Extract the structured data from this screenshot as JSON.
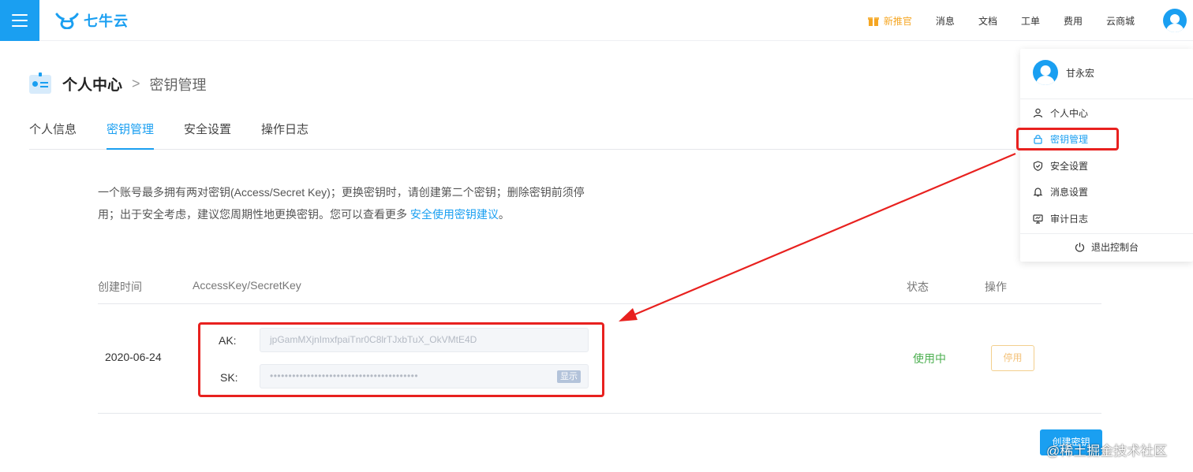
{
  "brand": {
    "name": "七牛云",
    "color": "#1a9ff1"
  },
  "topbar": {
    "promo": "新推官",
    "links": [
      "消息",
      "文档",
      "工单",
      "费用",
      "云商城"
    ]
  },
  "breadcrumb": {
    "main": "个人中心",
    "separator": ">",
    "current": "密钥管理"
  },
  "tabs": [
    {
      "label": "个人信息",
      "active": false
    },
    {
      "label": "密钥管理",
      "active": true
    },
    {
      "label": "安全设置",
      "active": false
    },
    {
      "label": "操作日志",
      "active": false
    }
  ],
  "description": {
    "line1": "一个账号最多拥有两对密钥(Access/Secret Key)；更换密钥时，请创建第二个密钥；删除密钥前须停",
    "line2": "用；出于安全考虑，建议您周期性地更换密钥。您可以查看更多 ",
    "link": "安全使用密钥建议",
    "suffix": "。"
  },
  "table": {
    "headers": {
      "created": "创建时间",
      "keys": "AccessKey/SecretKey",
      "status": "状态",
      "action": "操作"
    },
    "rows": [
      {
        "created": "2020-06-24",
        "ak_label": "AK:",
        "ak_value": "jpGamMXjnImxfpaiTnr0C8lrTJxbTuX_OkVMtE4D",
        "sk_label": "SK:",
        "sk_value": "••••••••••••••••••••••••••••••••••••••••",
        "show_label": "显示",
        "status": "使用中",
        "action": "停用"
      }
    ]
  },
  "create_button": "创建密钥",
  "dropdown": {
    "username": "甘永宏",
    "items": [
      {
        "label": "个人中心",
        "icon": "user-icon",
        "active": false
      },
      {
        "label": "密钥管理",
        "icon": "lock-icon",
        "active": true
      },
      {
        "label": "安全设置",
        "icon": "shield-icon",
        "active": false
      },
      {
        "label": "消息设置",
        "icon": "bell-icon",
        "active": false
      },
      {
        "label": "审计日志",
        "icon": "monitor-icon",
        "active": false
      }
    ],
    "logout": "退出控制台"
  },
  "watermark": "@稀土掘金技术社区",
  "colors": {
    "accent": "#1a9ff1",
    "annotation_red": "#e8211f",
    "status_green": "#4caf50",
    "warning": "#f5a623"
  }
}
